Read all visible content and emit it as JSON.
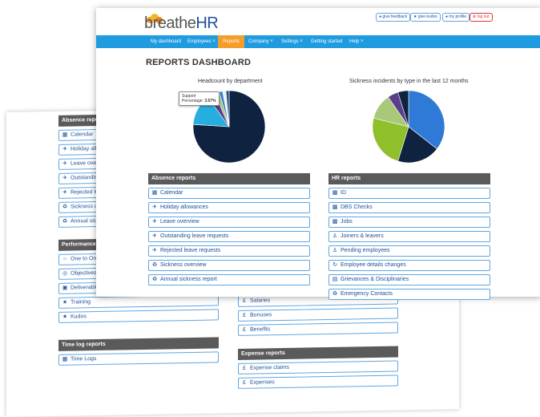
{
  "back": {
    "absence": {
      "title": "Absence reports",
      "items": [
        "Calendar",
        "Holiday allowances",
        "Leave overview",
        "Outstanding leave requests",
        "Rejected leave requests",
        "Sickness overview",
        "Annual sickness report"
      ]
    },
    "performance": {
      "title": "Performance reports",
      "items": [
        "One to Ones",
        "Objectives",
        "Deliverables",
        "Training",
        "Kudos"
      ]
    },
    "timelog": {
      "title": "Time log reports",
      "items": [
        "Time Logs"
      ]
    },
    "pay": {
      "items": [
        "Salaries",
        "Bonuses",
        "Benefits"
      ]
    },
    "expense": {
      "title": "Expense reports",
      "items": [
        "Expense claims",
        "Expenses"
      ]
    }
  },
  "header": {
    "logo_a": "breathe",
    "logo_b": "HR",
    "links": [
      "give feedback",
      "give kudos",
      "my profile",
      "log out"
    ]
  },
  "nav": [
    "My dashboard",
    "Employees",
    "Reports",
    "Company",
    "Settings",
    "Getting started",
    "Help"
  ],
  "page_title": "REPORTS DASHBOARD",
  "chart_data": [
    {
      "type": "pie",
      "title": "Headcount by department",
      "tooltip": {
        "label": "Support",
        "metric": "Percentage",
        "value": "3.57%"
      },
      "values": [
        76,
        14,
        3.57,
        2,
        1.5,
        1.5,
        1.43
      ],
      "colors": [
        "#0f2340",
        "#27aee0",
        "#5b3f8c",
        "#a8c97a",
        "#3a7ad0",
        "#f0f0f0",
        "#1f5a8a"
      ]
    },
    {
      "type": "pie",
      "title": "Sickness incidents by type in the last 12 months",
      "values": [
        37,
        20,
        25,
        12,
        5,
        5
      ],
      "colors": [
        "#2f7ad6",
        "#0f2340",
        "#8fbf2a",
        "#a8c97a",
        "#5b3f8c",
        "#0f2340"
      ]
    }
  ],
  "front": {
    "absence": {
      "title": "Absence reports",
      "items": [
        "Calendar",
        "Holiday allowances",
        "Leave overview",
        "Outstanding leave requests",
        "Rejected leave requests",
        "Sickness overview",
        "Annual sickness report"
      ]
    },
    "hr": {
      "title": "HR reports",
      "items": [
        "ID",
        "DBS Checks",
        "Jobs",
        "Joiners & leavers",
        "Pending employees",
        "Employee details changes",
        "Grievances & Disciplinaries",
        "Emergency Contacts"
      ]
    }
  }
}
